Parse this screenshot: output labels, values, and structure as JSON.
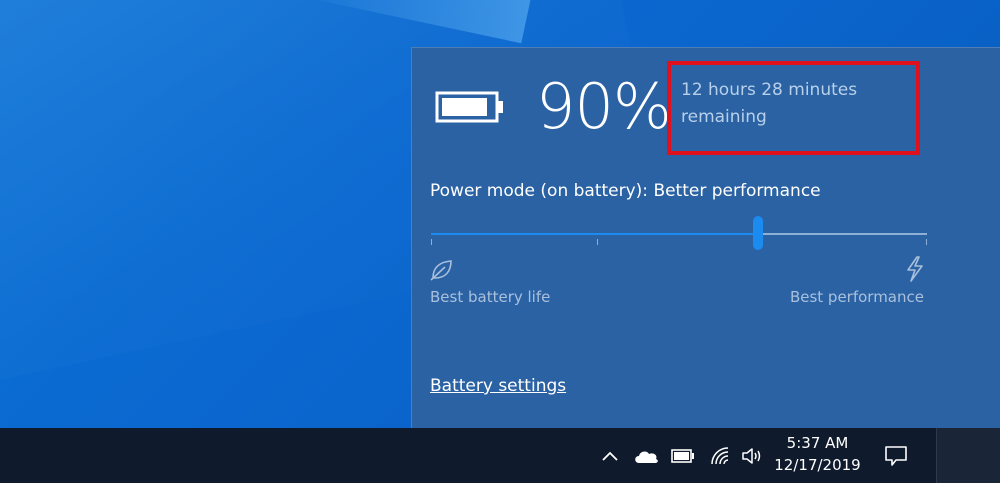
{
  "battery": {
    "percent_text": "90%",
    "charge_level": 0.9,
    "remaining": "12 hours 28 minutes remaining"
  },
  "power_mode": {
    "label": "Power mode (on battery): Better performance",
    "slider_value": 0.66,
    "min_label": "Best battery life",
    "max_label": "Best performance"
  },
  "battery_settings_link": "Battery settings",
  "taskbar": {
    "time": "5:37 AM",
    "date": "12/17/2019",
    "icons": [
      "chevron-up-icon",
      "onedrive-cloud-icon",
      "battery-icon",
      "wifi-icon",
      "speaker-icon",
      "action-center-icon"
    ]
  },
  "colors": {
    "highlight_box": "#e0101d",
    "slider_accent": "#1c8bf0",
    "flyout_bg": "#2a62a4",
    "taskbar_bg": "#0f1b2c"
  }
}
